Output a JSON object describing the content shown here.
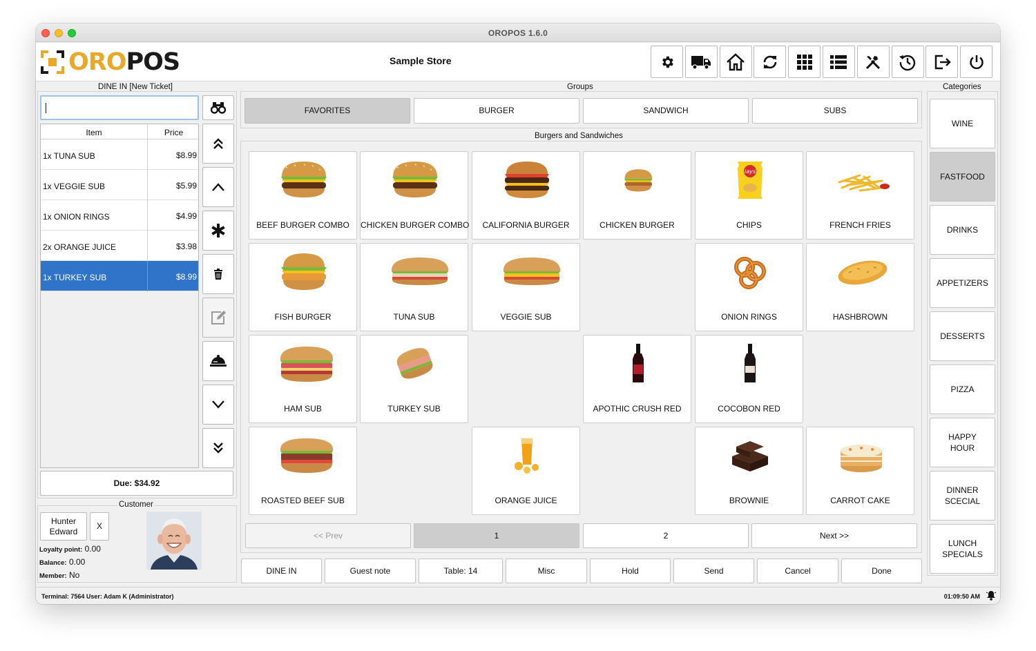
{
  "window": {
    "title": "OROPOS 1.6.0"
  },
  "header": {
    "logo_part1": "ORO",
    "logo_part2": "POS",
    "store_name": "Sample Store",
    "toolbar": [
      "settings",
      "delivery",
      "home",
      "refresh",
      "apps",
      "list",
      "tools",
      "clock-rewind",
      "logout",
      "power"
    ]
  },
  "ticket": {
    "title": "DINE IN [New Ticket]",
    "search_value": "",
    "columns": {
      "item": "Item",
      "price": "Price"
    },
    "rows": [
      {
        "name": "1x TUNA SUB",
        "price": "$8.99"
      },
      {
        "name": "1x VEGGIE SUB",
        "price": "$5.99"
      },
      {
        "name": "1x ONION RINGS",
        "price": "$4.99"
      },
      {
        "name": "2x ORANGE JUICE",
        "price": "$3.98"
      },
      {
        "name": "1x TURKEY SUB",
        "price": "$8.99"
      }
    ],
    "selected_index": 4,
    "due": "Due: $34.92"
  },
  "customer": {
    "title": "Customer",
    "name_line1": "Hunter",
    "name_line2": "Edward",
    "clear": "X",
    "loyalty_label": "Loyalty point:",
    "loyalty_value": "0.00",
    "balance_label": "Balance:",
    "balance_value": "0.00",
    "member_label": "Member:",
    "member_value": "No"
  },
  "groups": {
    "title": "Groups",
    "items": [
      "FAVORITES",
      "BURGER",
      "SANDWICH",
      "SUBS"
    ],
    "active": "FAVORITES"
  },
  "menu": {
    "title": "Burgers and Sandwiches",
    "items": [
      {
        "label": "BEEF BURGER COMBO",
        "icon": "burger-icon"
      },
      {
        "label": "CHICKEN BURGER COMBO",
        "icon": "burger-icon"
      },
      {
        "label": "CALIFORNIA BURGER",
        "icon": "burger-icon"
      },
      {
        "label": "CHICKEN BURGER",
        "icon": "burger-icon"
      },
      {
        "label": "CHIPS",
        "icon": "chips-icon"
      },
      {
        "label": "FRENCH FRIES",
        "icon": "fries-icon"
      },
      {
        "label": "FISH BURGER",
        "icon": "burger-icon"
      },
      {
        "label": "TUNA SUB",
        "icon": "sub-sandwich-icon"
      },
      {
        "label": "VEGGIE SUB",
        "icon": "sub-sandwich-icon"
      },
      {
        "label": "ONION RINGS",
        "icon": "onion-rings-icon"
      },
      {
        "label": "HASHBROWN",
        "icon": "hashbrown-icon"
      },
      {
        "label": "HAM SUB",
        "icon": "sub-sandwich-icon"
      },
      {
        "label": "TURKEY SUB",
        "icon": "sub-sandwich-icon"
      },
      {
        "label": "APOTHIC CRUSH RED",
        "icon": "wine-bottle-icon"
      },
      {
        "label": "COCOBON RED",
        "icon": "wine-bottle-icon"
      },
      {
        "label": "ROASTED BEEF SUB",
        "icon": "sub-sandwich-icon"
      },
      {
        "label": "ORANGE JUICE",
        "icon": "juice-glass-icon"
      },
      {
        "label": "BROWNIE",
        "icon": "brownie-icon"
      },
      {
        "label": "CARROT CAKE",
        "icon": "cake-icon"
      }
    ]
  },
  "pagination": {
    "prev": "<< Prev",
    "page1": "1",
    "page2": "2",
    "next": "Next >>"
  },
  "actions": [
    "DINE IN",
    "Guest note",
    "Table: 14",
    "Misc",
    "Hold",
    "Send",
    "Cancel",
    "Done"
  ],
  "categories": {
    "title": "Categories",
    "items": [
      "WINE",
      "FASTFOOD",
      "DRINKS",
      "APPETIZERS",
      "DESSERTS",
      "PIZZA",
      "HAPPY HOUR",
      "DINNER SCECIAL",
      "LUNCH SPECIALS"
    ],
    "active": "FASTFOOD"
  },
  "status": {
    "terminal": "Terminal: 7564  User: Adam K (Administrator)",
    "time": "01:09:50 AM"
  },
  "colors": {
    "accent": "#e8a92b",
    "selection": "#2f74c9",
    "active_button": "#cdcdcd"
  }
}
